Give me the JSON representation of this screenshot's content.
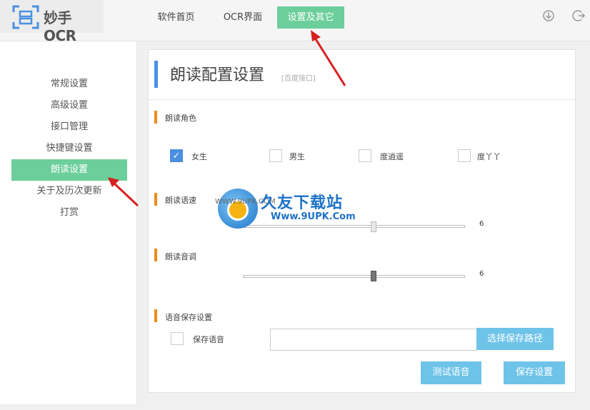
{
  "app": {
    "title": "妙手OCR"
  },
  "nav": [
    {
      "label": "软件首页"
    },
    {
      "label": "OCR界面"
    },
    {
      "label": "设置及其它",
      "active": true
    }
  ],
  "sidebar": {
    "items": [
      {
        "label": "常规设置"
      },
      {
        "label": "高级设置"
      },
      {
        "label": "接口管理"
      },
      {
        "label": "快捷键设置"
      },
      {
        "label": "朗读设置",
        "active": true
      },
      {
        "label": "关于及历次更新"
      },
      {
        "label": "打赏"
      }
    ]
  },
  "panel": {
    "title": "朗读配置设置",
    "subtitle": "[百度接口]",
    "role": {
      "label": "朗读角色",
      "options": [
        {
          "label": "女生",
          "checked": true
        },
        {
          "label": "男生",
          "checked": false
        },
        {
          "label": "度逍遥",
          "checked": false
        },
        {
          "label": "度丫丫",
          "checked": false
        }
      ]
    },
    "speed": {
      "label": "朗读语速",
      "value": "6"
    },
    "pitch": {
      "label": "朗读音调",
      "value": "6"
    },
    "save": {
      "label": "语音保存设置",
      "checkbox_label": "保存语音",
      "path_value": "",
      "browse_button": "选择保存路径"
    },
    "buttons": {
      "test": "测试语音",
      "save": "保存设置"
    }
  },
  "watermark": {
    "title": "久友下载站",
    "url": "Www.9UPK.Com",
    "small": "WWW.9UPK.COM"
  },
  "colors": {
    "accent_green": "#6ccf9b",
    "button_blue": "#6ec3e8",
    "section_orange": "#f08a1c",
    "title_blue": "#4a90e2",
    "arrow_red": "#d62020"
  }
}
